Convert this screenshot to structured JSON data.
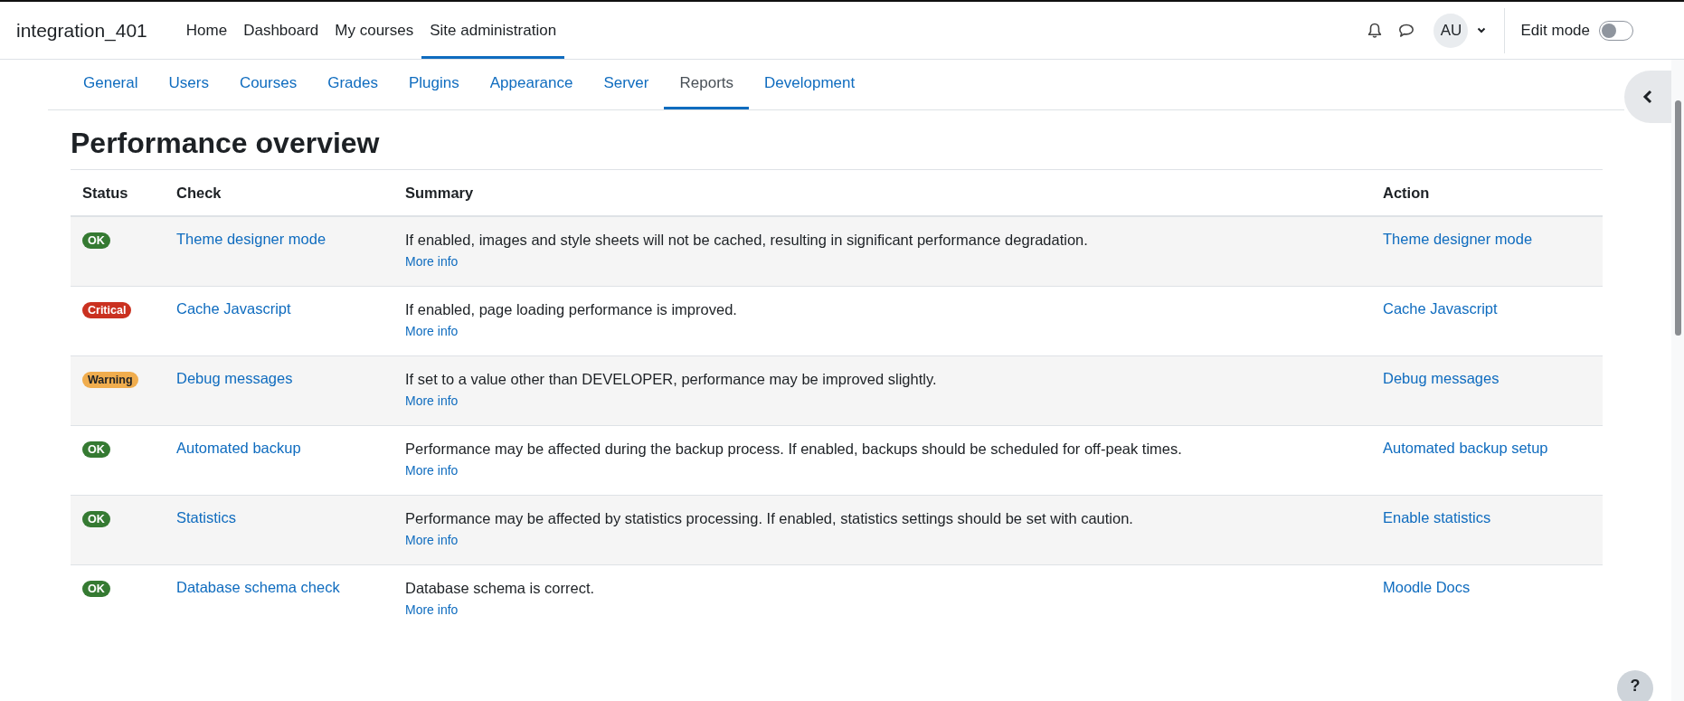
{
  "site_name": "integration_401",
  "primary_nav": [
    {
      "label": "Home",
      "selected": false
    },
    {
      "label": "Dashboard",
      "selected": false
    },
    {
      "label": "My courses",
      "selected": false
    },
    {
      "label": "Site administration",
      "selected": true
    }
  ],
  "user_menu": {
    "initials": "AU"
  },
  "edit_mode": {
    "label": "Edit mode",
    "on": false
  },
  "secondary_nav": [
    {
      "label": "General",
      "selected": false
    },
    {
      "label": "Users",
      "selected": false
    },
    {
      "label": "Courses",
      "selected": false
    },
    {
      "label": "Grades",
      "selected": false
    },
    {
      "label": "Plugins",
      "selected": false
    },
    {
      "label": "Appearance",
      "selected": false
    },
    {
      "label": "Server",
      "selected": false
    },
    {
      "label": "Reports",
      "selected": true
    },
    {
      "label": "Development",
      "selected": false
    }
  ],
  "page_title": "Performance overview",
  "table": {
    "columns": [
      "Status",
      "Check",
      "Summary",
      "Action"
    ],
    "rows": [
      {
        "status": "OK",
        "kind": "ok",
        "check": "Theme designer mode",
        "summary": "If enabled, images and style sheets will not be cached, resulting in significant performance degradation.",
        "more_info": "More info",
        "action": "Theme designer mode"
      },
      {
        "status": "Critical",
        "kind": "critical",
        "check": "Cache Javascript",
        "summary": "If enabled, page loading performance is improved.",
        "more_info": "More info",
        "action": "Cache Javascript"
      },
      {
        "status": "Warning",
        "kind": "warning",
        "check": "Debug messages",
        "summary": "If set to a value other than DEVELOPER, performance may be improved slightly.",
        "more_info": "More info",
        "action": "Debug messages"
      },
      {
        "status": "OK",
        "kind": "ok",
        "check": "Automated backup",
        "summary": "Performance may be affected during the backup process. If enabled, backups should be scheduled for off-peak times.",
        "more_info": "More info",
        "action": "Automated backup setup"
      },
      {
        "status": "OK",
        "kind": "ok",
        "check": "Statistics",
        "summary": "Performance may be affected by statistics processing. If enabled, statistics settings should be set with caution.",
        "more_info": "More info",
        "action": "Enable statistics"
      },
      {
        "status": "OK",
        "kind": "ok",
        "check": "Database schema check",
        "summary": "Database schema is correct.",
        "more_info": "More info",
        "action": "Moodle Docs"
      }
    ]
  },
  "help_button": {
    "label": "?"
  }
}
